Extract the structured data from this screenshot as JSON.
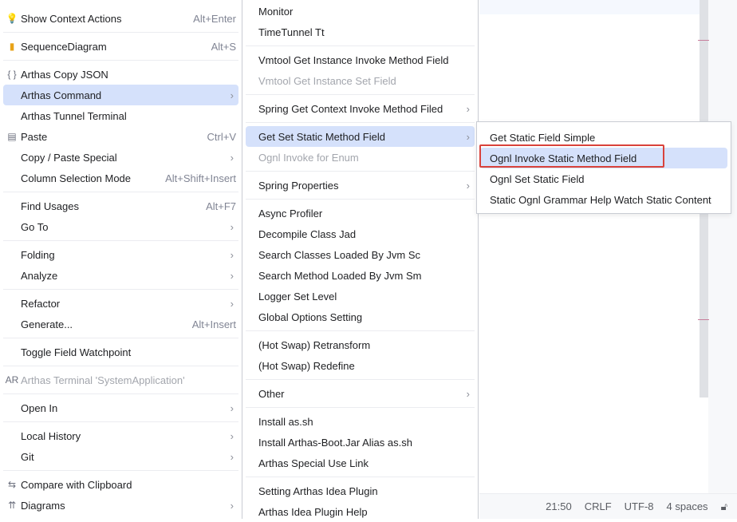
{
  "left_menu": [
    {
      "label": "Show Context Actions",
      "shortcut": "Alt+Enter",
      "icon": "lightbulb-icon",
      "glyph": "💡"
    },
    {
      "type": "sep"
    },
    {
      "label": "SequenceDiagram",
      "shortcut": "Alt+S",
      "icon": "sequence-diagram-icon",
      "glyph": "▮"
    },
    {
      "type": "sep"
    },
    {
      "label": "Arthas Copy JSON",
      "icon": "braces-icon",
      "glyph": "{ }"
    },
    {
      "label": "Arthas Command",
      "submenu": true,
      "selected": true
    },
    {
      "label": "Arthas Tunnel Terminal"
    },
    {
      "label": "Paste",
      "shortcut": "Ctrl+V",
      "icon": "clipboard-icon",
      "glyph": "▤"
    },
    {
      "label": "Copy / Paste Special",
      "submenu": true
    },
    {
      "label": "Column Selection Mode",
      "shortcut": "Alt+Shift+Insert"
    },
    {
      "type": "sep"
    },
    {
      "label": "Find Usages",
      "shortcut": "Alt+F7"
    },
    {
      "label": "Go To",
      "submenu": true
    },
    {
      "type": "sep"
    },
    {
      "label": "Folding",
      "submenu": true
    },
    {
      "label": "Analyze",
      "submenu": true
    },
    {
      "type": "sep"
    },
    {
      "label": "Refactor",
      "submenu": true
    },
    {
      "label": "Generate...",
      "shortcut": "Alt+Insert"
    },
    {
      "type": "sep"
    },
    {
      "label": "Toggle Field Watchpoint"
    },
    {
      "type": "sep"
    },
    {
      "label": "Arthas Terminal 'SystemApplication'",
      "disabled": true,
      "icon": "arthas-icon",
      "glyph": "AR"
    },
    {
      "type": "sep"
    },
    {
      "label": "Open In",
      "submenu": true
    },
    {
      "type": "sep"
    },
    {
      "label": "Local History",
      "submenu": true
    },
    {
      "label": "Git",
      "submenu": true
    },
    {
      "type": "sep"
    },
    {
      "label": "Compare with Clipboard",
      "icon": "compare-clipboard-icon",
      "glyph": "⇆"
    },
    {
      "label": "Diagrams",
      "submenu": true,
      "icon": "diagrams-icon",
      "glyph": "⇈"
    }
  ],
  "mid_menu": [
    {
      "label": "Monitor"
    },
    {
      "label": "TimeTunnel Tt"
    },
    {
      "type": "sep"
    },
    {
      "label": "Vmtool Get Instance Invoke Method Field"
    },
    {
      "label": "Vmtool Get Instance Set Field",
      "disabled": true
    },
    {
      "type": "sep"
    },
    {
      "label": "Spring Get Context Invoke Method Filed",
      "submenu": true
    },
    {
      "type": "sep"
    },
    {
      "label": "Get Set Static Method Field",
      "submenu": true,
      "selected": true
    },
    {
      "label": "Ognl Invoke for Enum",
      "disabled": true
    },
    {
      "type": "sep"
    },
    {
      "label": "Spring Properties",
      "submenu": true
    },
    {
      "type": "sep"
    },
    {
      "label": "Async Profiler"
    },
    {
      "label": "Decompile Class Jad"
    },
    {
      "label": "Search Classes Loaded By Jvm Sc"
    },
    {
      "label": "Search Method Loaded By Jvm Sm"
    },
    {
      "label": "Logger Set Level"
    },
    {
      "label": "Global Options Setting"
    },
    {
      "type": "sep"
    },
    {
      "label": "(Hot Swap) Retransform"
    },
    {
      "label": "(Hot Swap) Redefine"
    },
    {
      "type": "sep"
    },
    {
      "label": "Other",
      "submenu": true
    },
    {
      "type": "sep"
    },
    {
      "label": "Install as.sh"
    },
    {
      "label": "Install Arthas-Boot.Jar Alias as.sh"
    },
    {
      "label": "Arthas Special Use Link"
    },
    {
      "type": "sep"
    },
    {
      "label": "Setting Arthas Idea Plugin"
    },
    {
      "label": "Arthas Idea Plugin Help"
    }
  ],
  "sub_menu": [
    {
      "label": "Get Static Field Simple"
    },
    {
      "label": "Ognl Invoke Static Method Field",
      "selected": true
    },
    {
      "label": "Ognl Set Static Field"
    },
    {
      "label": "Static Ognl Grammar Help Watch Static Content"
    }
  ],
  "status_bar": {
    "position": "21:50",
    "line_ending": "CRLF",
    "encoding": "UTF-8",
    "indent": "4 spaces",
    "lock_icon": "unlock-icon"
  },
  "colors": {
    "selection": "#d5e1fb",
    "highlight_box": "#d9423b"
  }
}
